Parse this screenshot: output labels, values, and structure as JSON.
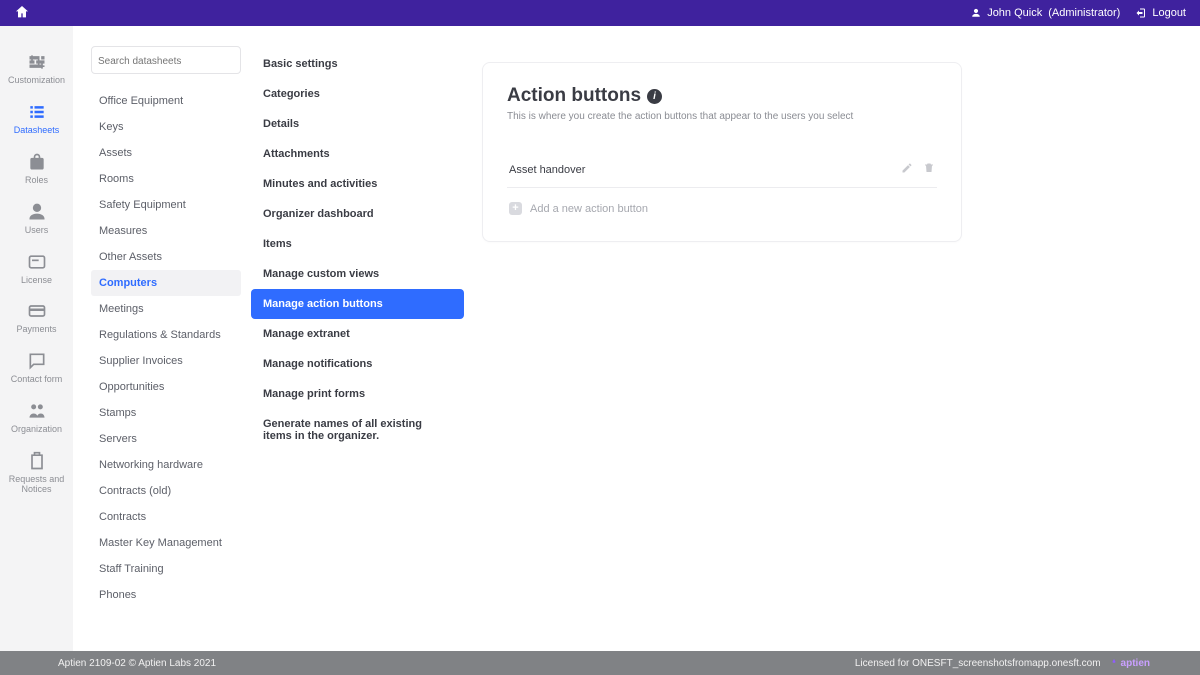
{
  "header": {
    "user_name": "John Quick",
    "user_role": "(Administrator)",
    "logout": "Logout"
  },
  "rail": [
    {
      "key": "customization",
      "label": "Customization"
    },
    {
      "key": "datasheets",
      "label": "Datasheets",
      "active": true
    },
    {
      "key": "roles",
      "label": "Roles"
    },
    {
      "key": "users",
      "label": "Users"
    },
    {
      "key": "license",
      "label": "License"
    },
    {
      "key": "payments",
      "label": "Payments"
    },
    {
      "key": "contact-form",
      "label": "Contact form"
    },
    {
      "key": "organization",
      "label": "Organization"
    },
    {
      "key": "requests",
      "label": "Requests and Notices"
    }
  ],
  "search": {
    "placeholder": "Search datasheets"
  },
  "datasheets": [
    "Office Equipment",
    "Keys",
    "Assets",
    "Rooms",
    "Safety Equipment",
    "Measures",
    "Other Assets",
    "Computers",
    "Meetings",
    "Regulations & Standards",
    "Supplier Invoices",
    "Opportunities",
    "Stamps",
    "Servers",
    "Networking hardware",
    "Contracts (old)",
    "Contracts",
    "Master Key Management",
    "Staff Training",
    "Phones"
  ],
  "datasheets_selected_index": 7,
  "settings_menu": [
    "Basic settings",
    "Categories",
    "Details",
    "Attachments",
    "Minutes and activities",
    "Organizer dashboard",
    "Items",
    "Manage custom views",
    "Manage action buttons",
    "Manage extranet",
    "Manage notifications",
    "Manage print forms",
    "Generate names of all existing items in the organizer."
  ],
  "settings_selected_index": 8,
  "panel": {
    "title": "Action buttons",
    "description": "This is where you create the action buttons that appear to the users you select",
    "actions": [
      "Asset handover"
    ],
    "add_label": "Add a new action button"
  },
  "footer": {
    "left": "Aptien 2109-02 © Aptien Labs 2021",
    "right": "Licensed for ONESFT_screenshotsfromapp.onesft.com",
    "brand": "aptien"
  }
}
